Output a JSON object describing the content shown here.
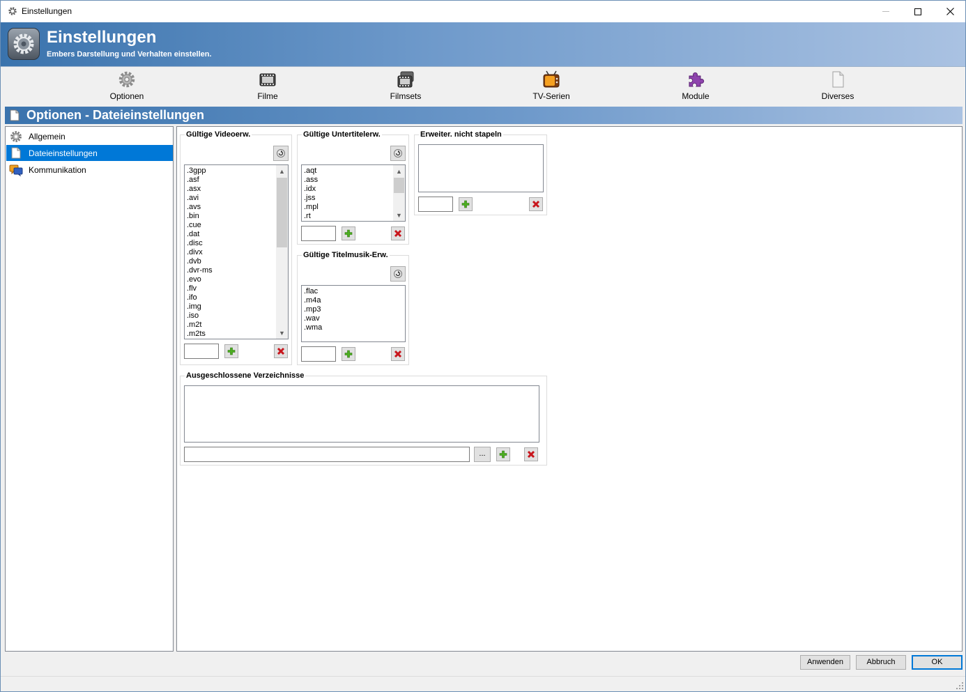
{
  "window": {
    "title": "Einstellungen"
  },
  "banner": {
    "title": "Einstellungen",
    "subtitle": "Embers Darstellung und Verhalten einstellen."
  },
  "toolbar": {
    "items": [
      {
        "label": "Optionen",
        "icon": "gear-icon"
      },
      {
        "label": "Filme",
        "icon": "film-icon"
      },
      {
        "label": "Filmsets",
        "icon": "filmset-icon"
      },
      {
        "label": "TV-Serien",
        "icon": "tv-icon"
      },
      {
        "label": "Module",
        "icon": "puzzle-icon"
      },
      {
        "label": "Diverses",
        "icon": "document-icon"
      }
    ]
  },
  "section": {
    "title": "Optionen - Dateieinstellungen"
  },
  "nav": {
    "items": [
      {
        "label": "Allgemein",
        "icon": "gear-icon",
        "selected": false
      },
      {
        "label": "Dateieinstellungen",
        "icon": "document-icon",
        "selected": true
      },
      {
        "label": "Kommunikation",
        "icon": "chat-icon",
        "selected": false
      }
    ]
  },
  "video": {
    "title": "Gültige Videoerw.",
    "items": [
      ".3gpp",
      ".asf",
      ".asx",
      ".avi",
      ".avs",
      ".bin",
      ".cue",
      ".dat",
      ".disc",
      ".divx",
      ".dvb",
      ".dvr-ms",
      ".evo",
      ".flv",
      ".ifo",
      ".img",
      ".iso",
      ".m2t",
      ".m2ts"
    ]
  },
  "subtitle": {
    "title": "Gültige Untertitelerw.",
    "items": [
      ".aqt",
      ".ass",
      ".idx",
      ".jss",
      ".mpl",
      ".rt"
    ]
  },
  "nostack": {
    "title": "Erweiter. nicht stapeln"
  },
  "music": {
    "title": "Gültige Titelmusik-Erw.",
    "items": [
      ".flac",
      ".m4a",
      ".mp3",
      ".wav",
      ".wma"
    ]
  },
  "excluded": {
    "title": "Ausgeschlossene Verzeichnisse",
    "browse_label": "..."
  },
  "footer": {
    "apply": "Anwenden",
    "cancel": "Abbruch",
    "ok": "OK"
  },
  "colors": {
    "accent": "#0078d7",
    "banner_start": "#3a73ad",
    "banner_end": "#aac2e2",
    "add_green": "#4caf20",
    "remove_red": "#c8161d"
  }
}
